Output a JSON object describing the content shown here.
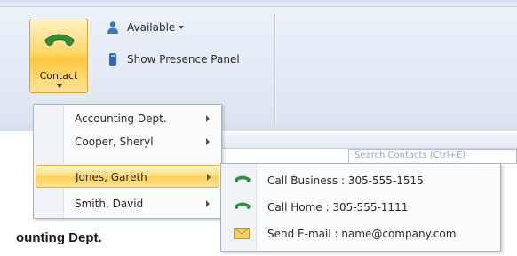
{
  "ribbon": {
    "contact_button": {
      "label": "Contact",
      "icon": "phone-handset-icon"
    },
    "available": {
      "label": "Available",
      "icon": "presence-person-icon"
    },
    "show_presence_panel": {
      "label": "Show Presence Panel",
      "icon": "presence-panel-icon"
    }
  },
  "contact_menu": {
    "items": [
      {
        "label": "Accounting Dept."
      },
      {
        "label": "Cooper, Sheryl"
      },
      {
        "label": "Jones, Gareth"
      },
      {
        "label": "Smith, David"
      }
    ]
  },
  "contact_submenu": {
    "items": [
      {
        "label": "Call Business : 305-555-1515",
        "icon": "phone-icon"
      },
      {
        "label": "Call Home : 305-555-1111",
        "icon": "phone-icon"
      },
      {
        "label": "Send E-mail : name@company.com",
        "icon": "envelope-icon"
      }
    ]
  },
  "search": {
    "placeholder": "Search Contacts (Ctrl+E)"
  },
  "section": {
    "heading": "ounting Dept."
  },
  "colors": {
    "highlight": "#ffd86b",
    "phone_green": "#2e8b3a",
    "envelope": "#e8c24a"
  }
}
